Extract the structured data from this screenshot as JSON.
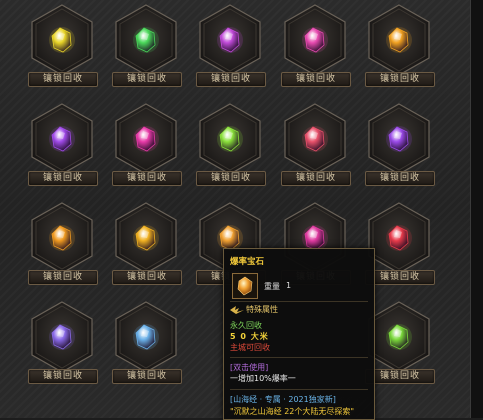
{
  "inventory": {
    "button_label": "镶锁回收",
    "slots": [
      {
        "gem_color": "#e8d428",
        "gem_name": "yellow-gem-icon"
      },
      {
        "gem_color": "#4ad85a",
        "gem_name": "green-gem-icon"
      },
      {
        "gem_color": "#c04ad8",
        "gem_name": "purple-gem-icon"
      },
      {
        "gem_color": "#e84ab0",
        "gem_name": "pink-gem-icon"
      },
      {
        "gem_color": "#f0a020",
        "gem_name": "orange-gem-icon"
      },
      {
        "gem_color": "#a04ae8",
        "gem_name": "violet-gem-icon"
      },
      {
        "gem_color": "#e83aa8",
        "gem_name": "magenta-gem-icon"
      },
      {
        "gem_color": "#8ae03a",
        "gem_name": "lime-gem-icon"
      },
      {
        "gem_color": "#e8506a",
        "gem_name": "rose-gem-icon"
      },
      {
        "gem_color": "#9a4ae8",
        "gem_name": "violet-gem-icon"
      },
      {
        "gem_color": "#f09a20",
        "gem_name": "amber-gem-icon"
      },
      {
        "gem_color": "#f0b020",
        "gem_name": "amber-gem-icon"
      },
      {
        "gem_color": "#f0a030",
        "gem_name": "amber-gem-icon"
      },
      {
        "gem_color": "#e03aa0",
        "gem_name": "magenta-gem-icon"
      },
      {
        "gem_color": "#e83a4a",
        "gem_name": "red-gem-icon"
      },
      {
        "gem_color": "#8a6ae8",
        "gem_name": "lavender-gem-icon"
      },
      {
        "gem_color": "#6ab0e8",
        "gem_name": "blue-gem-icon"
      },
      {
        "gem_color": "#7ad83a",
        "gem_name": "green-gem-icon"
      }
    ]
  },
  "tooltip": {
    "title": "爆率宝石",
    "weight_label": "重量",
    "weight_value": "1",
    "section_label": "特殊属性",
    "perm_recycle": "永久回收",
    "value_line": "5 0 大米",
    "drop_line": "主城可回收",
    "click_use": "[双击使用]",
    "bonus_line": "一增加10%爆率一",
    "exclusive_line": "[山海经 · 专属 · 2021独家新]",
    "quote_line": "\"沉默之山海经 22个大陆无尽探索\"",
    "accent_color": "#f2c93a"
  }
}
